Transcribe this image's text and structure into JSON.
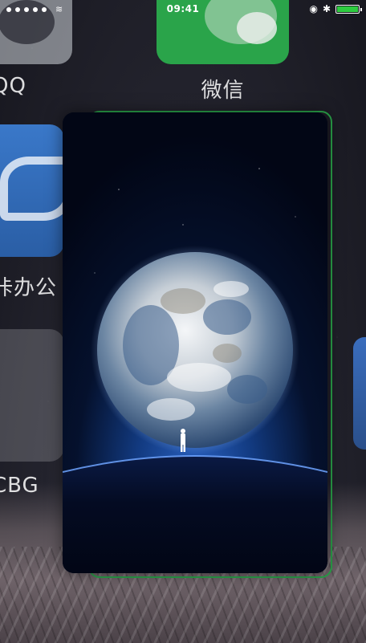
{
  "status_bar": {
    "time": "09:41",
    "signal_dots": 5,
    "battery_level_pct": 100,
    "battery_color": "#2ecc40"
  },
  "apps": [
    {
      "label": "QQ",
      "icon": "qq-icon"
    },
    {
      "label": "微信",
      "icon": "wechat-icon",
      "color": "#2aa44a"
    },
    {
      "label": "咔办公",
      "icon": "app-icon"
    },
    {
      "label": "CBG",
      "icon": "app-icon"
    }
  ],
  "splash": {
    "image": "earth-planet-with-figure",
    "background_color": "#020615",
    "glow_color": "#2a60b8"
  }
}
